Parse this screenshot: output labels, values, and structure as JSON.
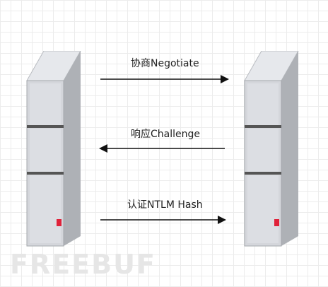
{
  "diagram": {
    "messages": [
      {
        "label": "协商Negotiate",
        "direction": "right"
      },
      {
        "label": "响应Challenge",
        "direction": "left"
      },
      {
        "label": "认证NTLM Hash",
        "direction": "right"
      }
    ],
    "watermark": "FREEBUF"
  },
  "colors": {
    "server_front": "#d4d6db",
    "server_side": "#aeb1b6",
    "server_top": "#e6e8ec",
    "server_divider": "#555555",
    "led": "#e0223a",
    "arrow": "#111111"
  }
}
